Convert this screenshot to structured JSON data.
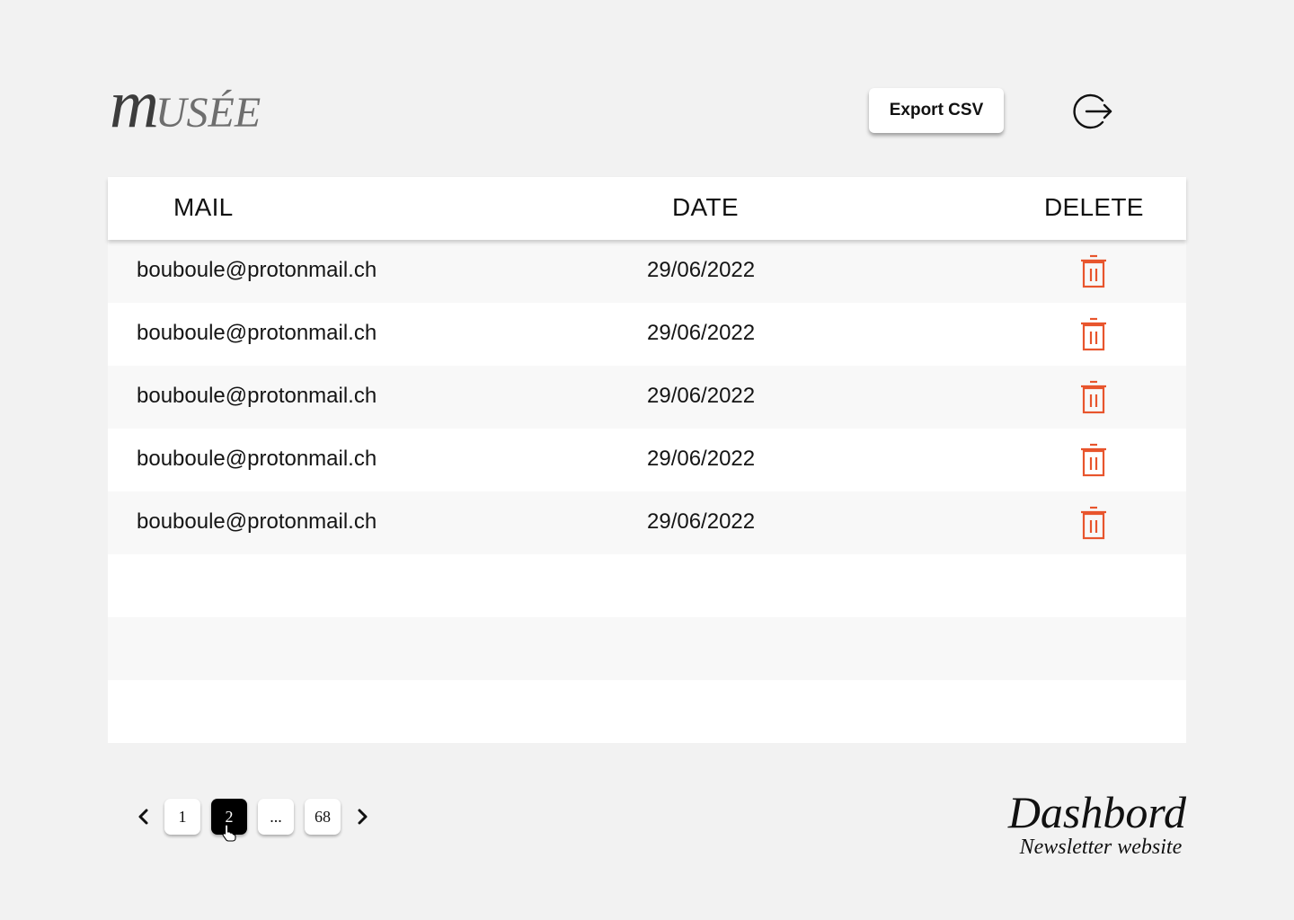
{
  "logo": {
    "initial": "m",
    "rest": "USÉE"
  },
  "header": {
    "export_label": "Export CSV",
    "logout_icon": "logout-icon"
  },
  "table": {
    "columns": [
      "MAIL",
      "DATE",
      "DELETE"
    ],
    "rows": [
      {
        "mail": "bouboule@protonmail.ch",
        "date": "29/06/2022"
      },
      {
        "mail": "bouboule@protonmail.ch",
        "date": "29/06/2022"
      },
      {
        "mail": "bouboule@protonmail.ch",
        "date": "29/06/2022"
      },
      {
        "mail": "bouboule@protonmail.ch",
        "date": "29/06/2022"
      },
      {
        "mail": "bouboule@protonmail.ch",
        "date": "29/06/2022"
      }
    ]
  },
  "pagination": {
    "pages": [
      "1",
      "2",
      "...",
      "68"
    ],
    "current": "2"
  },
  "brand": {
    "title": "Dashbord",
    "subtitle": "Newsletter website"
  },
  "colors": {
    "delete_icon": "#e8552d",
    "background": "#f2f2f2",
    "active_page": "#000000"
  }
}
